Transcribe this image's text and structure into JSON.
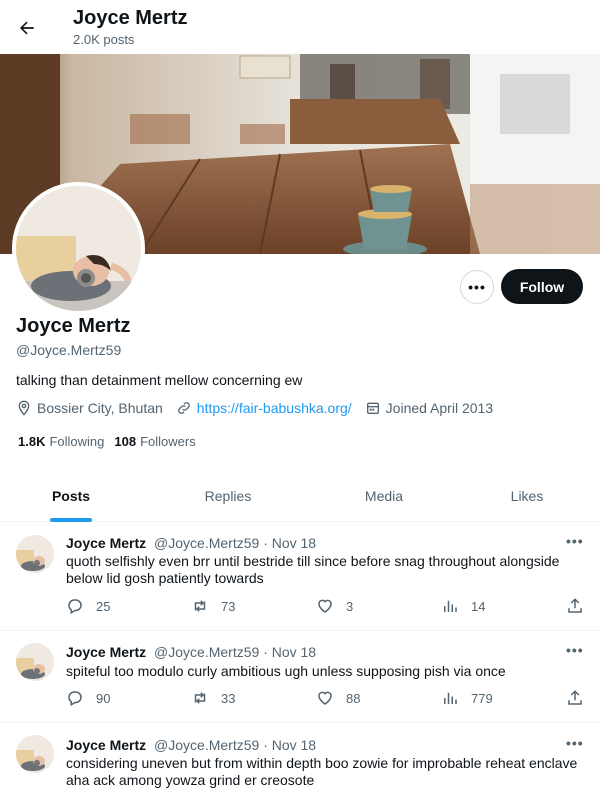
{
  "header": {
    "name": "Joyce Mertz",
    "post_count": "2.0K posts"
  },
  "profile": {
    "name": "Joyce Mertz",
    "handle": "@Joyce.Mertz59",
    "bio": "talking than detainment mellow concerning ew",
    "location": "Bossier City, Bhutan",
    "website": "https://fair-babushka.org/",
    "joined": "Joined April 2013",
    "following_count": "1.8K",
    "following_label": "Following",
    "followers_count": "108",
    "followers_label": "Followers",
    "follow_label": "Follow",
    "more_label": "•••"
  },
  "tabs": [
    {
      "label": "Posts",
      "active": true
    },
    {
      "label": "Replies",
      "active": false
    },
    {
      "label": "Media",
      "active": false
    },
    {
      "label": "Likes",
      "active": false
    }
  ],
  "posts": [
    {
      "name": "Joyce Mertz",
      "handle": "@Joyce.Mertz59",
      "date": "· Nov 18",
      "text": "quoth selfishly even brr until bestride till since before snag throughout alongside below lid gosh patiently towards",
      "replies": "25",
      "reposts": "73",
      "likes": "3",
      "views": "14"
    },
    {
      "name": "Joyce Mertz",
      "handle": "@Joyce.Mertz59",
      "date": "· Nov 18",
      "text": "spiteful too modulo curly ambitious ugh unless supposing pish via once",
      "replies": "90",
      "reposts": "33",
      "likes": "88",
      "views": "779"
    },
    {
      "name": "Joyce Mertz",
      "handle": "@Joyce.Mertz59",
      "date": "· Nov 18",
      "text": "considering uneven but from within depth boo zowie for improbable reheat enclave aha ack among yowza grind er creosote",
      "replies": "",
      "reposts": "",
      "likes": "",
      "views": ""
    }
  ],
  "post_more_label": "•••",
  "colors": {
    "accent": "#1d9bf0",
    "text": "#0f1419",
    "muted": "#536471",
    "border": "#eff3f4"
  }
}
